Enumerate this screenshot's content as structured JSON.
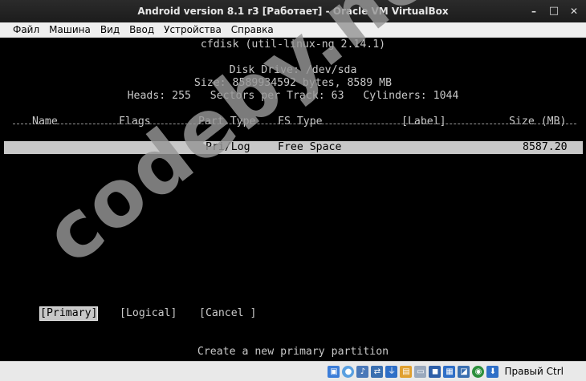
{
  "window": {
    "title": "Android version 8.1 r3 [Работает] - Oracle VM VirtualBox",
    "controls": {
      "minimize": "–",
      "maximize": "□",
      "close": "✕"
    }
  },
  "menubar": {
    "items": [
      "Файл",
      "Машина",
      "Вид",
      "Ввод",
      "Устройства",
      "Справка"
    ]
  },
  "cfdisk": {
    "version": "cfdisk (util-linux-ng 2.14.1)",
    "disk_drive": "Disk Drive: /dev/sda",
    "size_line": "Size: 8589934592 bytes, 8589 MB",
    "geometry_line": "Heads: 255   Sectors per Track: 63   Cylinders: 1044",
    "columns": {
      "name": "Name",
      "flags": "Flags",
      "part_type": "Part Type",
      "fs_type": "FS Type",
      "label": "[Label]",
      "size": "Size (MB)"
    },
    "rows": [
      {
        "part_type": "Pri/Log",
        "fs_type": "Free Space",
        "size": "8587.20"
      }
    ],
    "options": [
      "[Primary]",
      "[Logical]",
      "[Cancel ]"
    ],
    "selected_option": "[Primary]",
    "help_text": "Create a new primary partition"
  },
  "watermark": "codeby.net",
  "statusbar": {
    "host_key": "Правый Ctrl",
    "icons": [
      {
        "name": "hdd-icon",
        "color": "#3b7dd8"
      },
      {
        "name": "optical-drive-icon",
        "color": "#5aa0e0"
      },
      {
        "name": "audio-icon",
        "color": "#4a78b8"
      },
      {
        "name": "network-icon",
        "color": "#3a6fb0"
      },
      {
        "name": "usb-icon",
        "color": "#2f6fc7"
      },
      {
        "name": "shared-folders-icon",
        "color": "#e0a030"
      },
      {
        "name": "display-icon",
        "color": "#9aa9bd"
      },
      {
        "name": "video-capture-icon",
        "color": "#2e5fa8"
      },
      {
        "name": "clipboard-icon",
        "color": "#2f6fc7"
      },
      {
        "name": "mouse-integration-icon",
        "color": "#3a6fb0"
      },
      {
        "name": "virtualization-icon",
        "color": "#2c8f3c"
      },
      {
        "name": "keyboard-capture-icon",
        "color": "#2f6fc7"
      }
    ]
  }
}
